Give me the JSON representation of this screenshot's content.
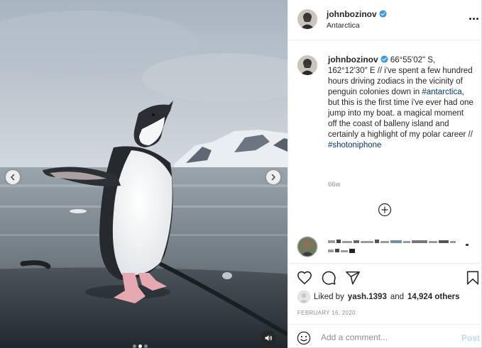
{
  "header": {
    "username": "johnbozinov",
    "location": "Antarctica",
    "verified_icon": "verified-badge-icon",
    "more_icon": "more-options-icon"
  },
  "caption": {
    "username": "johnbozinov",
    "text_before_tag1": "66°55'02\" S, 162°12'30\" E // i've spent a few hundred hours driving zodiacs in the vicinity of penguin colonies down in ",
    "hashtag1": "#antarctica",
    "text_after_tag1": ", but this is the first time i've ever had one jump into my boat. a magical moment off the coast of balleny island and certainly a highlight of my polar career // ",
    "hashtag2": "#shotoniphone",
    "time_ago": "66w"
  },
  "actions": {
    "like_icon": "heart-icon",
    "comment_icon": "comment-icon",
    "share_icon": "share-icon",
    "save_icon": "bookmark-icon"
  },
  "likes": {
    "prefix": "Liked by",
    "liker": "yash.1393",
    "and": "and",
    "count": "14,924 others"
  },
  "date": "FEBRUARY 16, 2020",
  "add_comment": {
    "placeholder": "Add a comment...",
    "post_label": "Post"
  },
  "colors": {
    "link_blue": "#0095f6",
    "post_disabled": "#b3dbff",
    "hashtag": "#00376b",
    "muted_text": "#8e8e8e"
  },
  "media": {
    "carousel_index": 2,
    "carousel_count": 3
  }
}
